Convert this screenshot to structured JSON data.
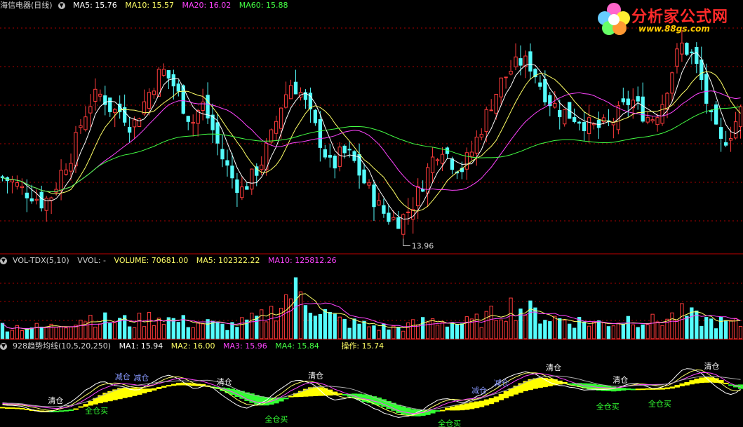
{
  "main_header": {
    "stock": "海信电器(日线)",
    "ma5": "MA5: 15.76",
    "ma10": "MA10: 15.57",
    "ma20": "MA20: 16.02",
    "ma60": "MA60: 15.88"
  },
  "vol_header": {
    "name": "VOL-TDX(5,10)",
    "vvol": "VVOL: -",
    "volume": "VOLUME: 70681.00",
    "ma5": "MA5: 102322.22",
    "ma10": "MA10: 125812.26"
  },
  "ind_header": {
    "name": "928趋势均线(10,5,20,250)",
    "ma1": "MA1: 15.94",
    "ma2": "MA2: 16.00",
    "ma3": "MA3: 15.96",
    "ma4": "MA4: 15.84",
    "op": "操作: 15.74"
  },
  "logo": {
    "title": "分析家公式网",
    "url": "www.88gs.com"
  },
  "colors": {
    "up": "#ff3b3b",
    "down": "#54fcfc",
    "ma5": "#ffffff",
    "ma10": "#ffff66",
    "ma20": "#ff44ff",
    "ma60": "#44ff44",
    "grid": "#aa0000",
    "yellow": "#ffff00",
    "green": "#33ff33"
  },
  "chart_data": [
    {
      "type": "candlestick",
      "title": "海信电器(日线)",
      "price_range": [
        13.2,
        19.0
      ],
      "low_marker": {
        "label": "13.96",
        "value": 13.96
      },
      "series": [
        {
          "name": "MA5",
          "last": 15.76
        },
        {
          "name": "MA10",
          "last": 15.57
        },
        {
          "name": "MA20",
          "last": 16.02
        },
        {
          "name": "MA60",
          "last": 15.88
        }
      ],
      "close_path": [
        15.0,
        14.9,
        14.7,
        14.6,
        14.4,
        14.6,
        15.2,
        15.6,
        16.4,
        16.9,
        17.0,
        16.6,
        16.6,
        16.2,
        16.7,
        17.2,
        17.6,
        17.3,
        16.8,
        16.3,
        16.8,
        16.2,
        15.5,
        15.0,
        14.7,
        15.0,
        15.4,
        16.0,
        16.8,
        17.3,
        17.0,
        16.4,
        15.8,
        15.2,
        15.6,
        15.5,
        15.0,
        14.6,
        14.2,
        14.0,
        14.0,
        14.3,
        14.8,
        15.4,
        15.8,
        15.4,
        15.2,
        15.6,
        16.2,
        16.8,
        17.3,
        17.6,
        17.8,
        17.7,
        17.2,
        16.8,
        16.6,
        16.5,
        16.4,
        16.2,
        16.2,
        16.3,
        16.6,
        16.9,
        16.6,
        16.4,
        16.7,
        17.5,
        18.2,
        18.0,
        17.4,
        16.4,
        15.8,
        16.1,
        16.6
      ],
      "volume_max": 380000,
      "volume_path": [
        70,
        60,
        65,
        60,
        58,
        62,
        80,
        95,
        110,
        115,
        100,
        90,
        95,
        80,
        100,
        110,
        120,
        95,
        90,
        80,
        85,
        75,
        65,
        70,
        80,
        95,
        110,
        140,
        190,
        250,
        230,
        190,
        150,
        110,
        90,
        80,
        75,
        65,
        60,
        55,
        60,
        70,
        85,
        95,
        90,
        85,
        80,
        85,
        100,
        120,
        150,
        170,
        160,
        140,
        120,
        110,
        100,
        95,
        90,
        85,
        80,
        85,
        95,
        110,
        100,
        90,
        95,
        110,
        130,
        115,
        100,
        90,
        85,
        80,
        75
      ],
      "volume_ma5_last": 102322.22,
      "volume_ma10_last": 125812.26,
      "volume_last": 70681.0
    },
    {
      "type": "indicator",
      "title": "928趋势均线(10,5,20,250)",
      "series": [
        {
          "name": "MA1",
          "last": 15.94
        },
        {
          "name": "MA2",
          "last": 16.0
        },
        {
          "name": "MA3",
          "last": 15.96
        },
        {
          "name": "MA4",
          "last": 15.84
        },
        {
          "name": "操作",
          "last": 15.74
        }
      ],
      "signals": [
        {
          "label": "清仓",
          "kind": "sell",
          "pos": 0.075
        },
        {
          "label": "全仓买",
          "kind": "buy",
          "pos": 0.13
        },
        {
          "label": "减仓",
          "kind": "reduce",
          "pos": 0.165
        },
        {
          "label": "减仓",
          "kind": "reduce",
          "pos": 0.19
        },
        {
          "label": "清仓",
          "kind": "sell",
          "pos": 0.302
        },
        {
          "label": "全仓买",
          "kind": "buy",
          "pos": 0.372
        },
        {
          "label": "清仓",
          "kind": "sell",
          "pos": 0.425
        },
        {
          "label": "全仓买",
          "kind": "buy",
          "pos": 0.605
        },
        {
          "label": "减仓",
          "kind": "reduce",
          "pos": 0.645
        },
        {
          "label": "减仓",
          "kind": "reduce",
          "pos": 0.675
        },
        {
          "label": "清仓",
          "kind": "sell",
          "pos": 0.745
        },
        {
          "label": "清仓",
          "kind": "sell",
          "pos": 0.835
        },
        {
          "label": "全仓买",
          "kind": "buy",
          "pos": 0.818
        },
        {
          "label": "全仓买",
          "kind": "buy",
          "pos": 0.888
        },
        {
          "label": "清仓",
          "kind": "sell",
          "pos": 0.958
        }
      ]
    }
  ]
}
